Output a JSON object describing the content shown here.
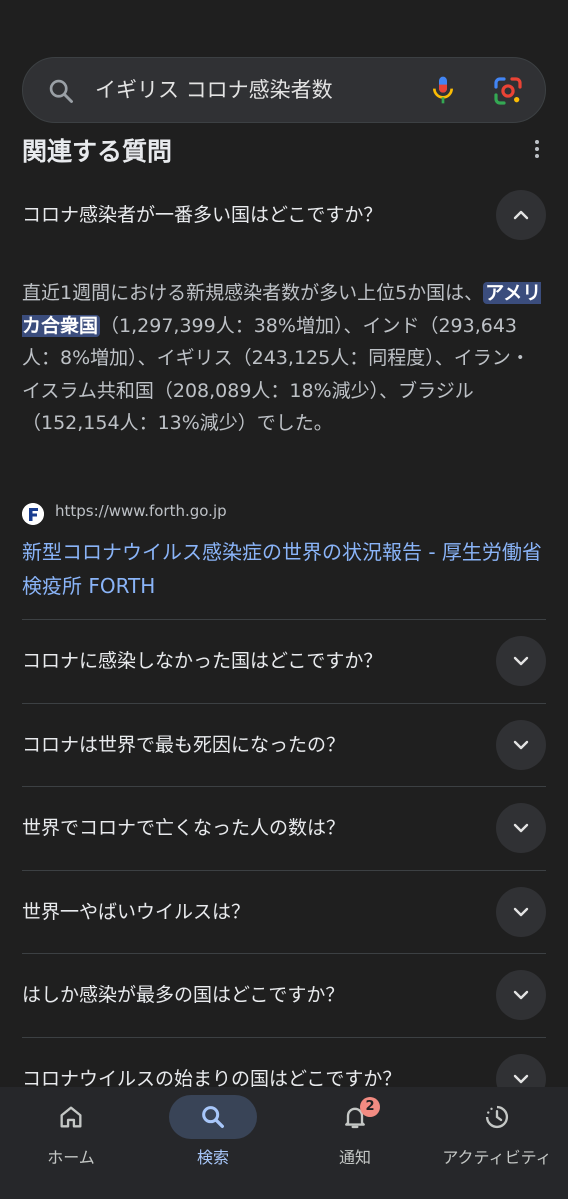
{
  "search": {
    "query": "イギリス コロナ感染者数"
  },
  "section": {
    "title": "関連する質問"
  },
  "expanded": {
    "question": "コロナ感染者が一番多い国はどこですか？",
    "answer_before": "直近1週間における新規感染者数が多い上位5か国は、",
    "answer_highlight": "アメリカ合衆国",
    "answer_after": "（1,297,399人：38%増加）、インド（293,643人：8%増加）、イギリス（243,125人：同程度）、イラン・イスラム共和国（208,089人：18%減少）、ブラジル（152,154人：13%減少）でした。",
    "source_url": "https://www.forth.go.jp",
    "source_title": "新型コロナウイルス感染症の世界の状況報告 - 厚生労働省検疫所 FORTH"
  },
  "questions": [
    "コロナに感染しなかった国はどこですか？",
    "コロナは世界で最も死因になったの？",
    "世界でコロナで亡くなった人の数は？",
    "世界一やばいウイルスは？",
    "はしか感染が最多の国はどこですか？",
    "コロナウイルスの始まりの国はどこですか？"
  ],
  "nav": {
    "home": "ホーム",
    "search": "検索",
    "notifications": "通知",
    "notifications_badge": "2",
    "activity": "アクティビティ"
  },
  "colors": {
    "background": "#1f1f1f",
    "link": "#8ab4f8",
    "highlight": "#3b4d7d",
    "active_nav": "#a8c7fa",
    "badge": "#f28b82"
  }
}
